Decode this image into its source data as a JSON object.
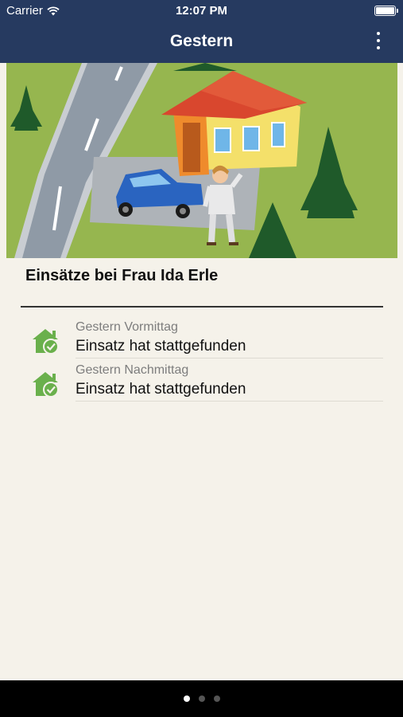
{
  "status_bar": {
    "carrier": "Carrier",
    "time": "12:07 PM",
    "icons": [
      "wifi-icon",
      "battery-icon"
    ]
  },
  "nav": {
    "title": "Gestern",
    "menu_icon": "more-vertical-icon"
  },
  "hero_image": {
    "depicts": [
      "road",
      "house",
      "car",
      "woman",
      "trees"
    ]
  },
  "section": {
    "title": "Einsätze bei Frau Ida Erle"
  },
  "entries": [
    {
      "label": "Gestern Vormittag",
      "value": "Einsatz hat stattgefunden",
      "icon": "house-check-icon"
    },
    {
      "label": "Gestern Nachmittag",
      "value": "Einsatz hat stattgefunden",
      "icon": "house-check-icon"
    }
  ],
  "page_indicator": {
    "count": 3,
    "active_index": 0
  },
  "colors": {
    "nav_background": "#263a60",
    "page_background": "#f5f2ea",
    "icon_green": "#6ab04c",
    "bottom_bar": "#000000"
  }
}
